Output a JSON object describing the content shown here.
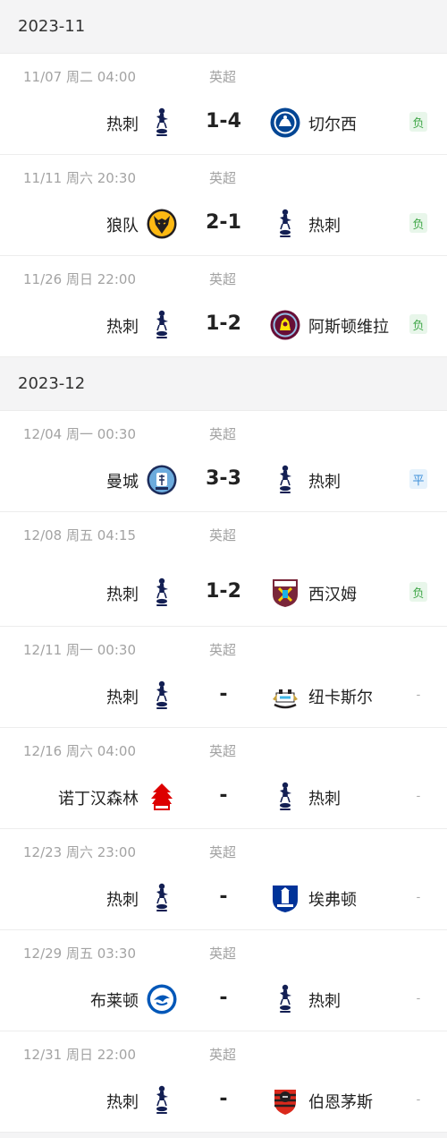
{
  "months": [
    {
      "label": "2023-11",
      "matches": [
        {
          "time": "11/07  周二 04:00",
          "comp": "英超",
          "home": "热刺",
          "home_logo": "spurs",
          "score": "1-4",
          "away": "切尔西",
          "away_logo": "chelsea",
          "result": "负",
          "result_type": "lose"
        },
        {
          "time": "11/11  周六 20:30",
          "comp": "英超",
          "home": "狼队",
          "home_logo": "wolves",
          "score": "2-1",
          "away": "热刺",
          "away_logo": "spurs",
          "result": "负",
          "result_type": "lose"
        },
        {
          "time": "11/26  周日 22:00",
          "comp": "英超",
          "home": "热刺",
          "home_logo": "spurs",
          "score": "1-2",
          "away": "阿斯顿维拉",
          "away_logo": "villa",
          "result": "负",
          "result_type": "lose"
        }
      ]
    },
    {
      "label": "2023-12",
      "matches": [
        {
          "time": "12/04  周一 00:30",
          "comp": "英超",
          "home": "曼城",
          "home_logo": "mancity",
          "score": "3-3",
          "away": "热刺",
          "away_logo": "spurs",
          "result": "平",
          "result_type": "draw"
        },
        {
          "time": "12/08  周五 04:15",
          "comp": "英超",
          "home": "热刺",
          "home_logo": "spurs",
          "score": "1-2",
          "away": "西汉姆",
          "away_logo": "westham",
          "result": "负",
          "result_type": "lose",
          "tall": true
        },
        {
          "time": "12/11  周一 00:30",
          "comp": "英超",
          "home": "热刺",
          "home_logo": "spurs",
          "score": "-",
          "away": "纽卡斯尔",
          "away_logo": "newcastle",
          "result": "-",
          "result_type": "none"
        },
        {
          "time": "12/16  周六 04:00",
          "comp": "英超",
          "home": "诺丁汉森林",
          "home_logo": "forest",
          "score": "-",
          "away": "热刺",
          "away_logo": "spurs",
          "result": "-",
          "result_type": "none"
        },
        {
          "time": "12/23  周六 23:00",
          "comp": "英超",
          "home": "热刺",
          "home_logo": "spurs",
          "score": "-",
          "away": "埃弗顿",
          "away_logo": "everton",
          "result": "-",
          "result_type": "none"
        },
        {
          "time": "12/29  周五 03:30",
          "comp": "英超",
          "home": "布莱顿",
          "home_logo": "brighton",
          "score": "-",
          "away": "热刺",
          "away_logo": "spurs",
          "result": "-",
          "result_type": "none"
        },
        {
          "time": "12/31  周日 22:00",
          "comp": "英超",
          "home": "热刺",
          "home_logo": "spurs",
          "score": "-",
          "away": "伯恩茅斯",
          "away_logo": "bournemouth",
          "result": "-",
          "result_type": "none"
        }
      ]
    }
  ],
  "colors": {
    "lose_bg": "#e8f6ea",
    "lose_text": "#42a84a",
    "draw_bg": "#e6f2fc",
    "draw_text": "#3c8fd9",
    "muted": "#a3a3a3",
    "header_bg": "#f4f4f5"
  }
}
